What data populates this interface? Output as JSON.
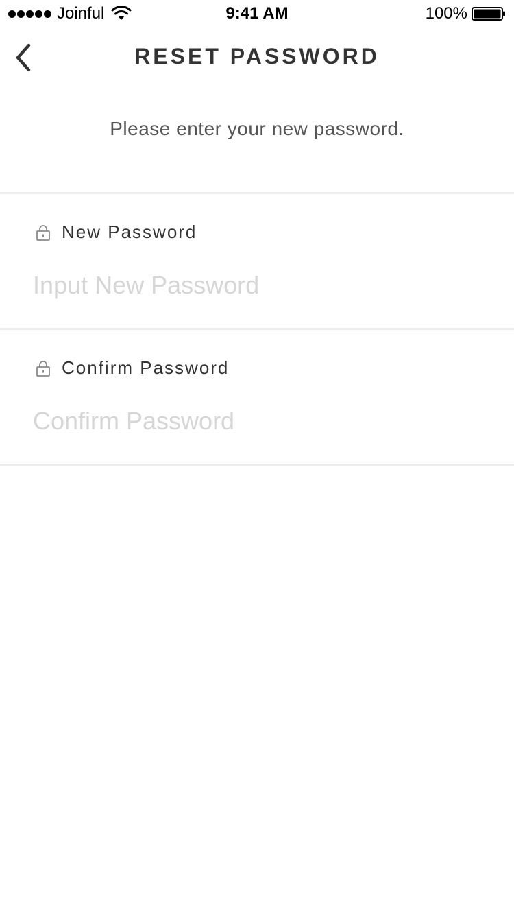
{
  "status_bar": {
    "carrier": "Joinful",
    "time": "9:41 AM",
    "battery_percent": "100%",
    "signal_icon": "signal-dots-icon",
    "wifi_icon": "wifi-icon",
    "battery_icon": "battery-full-icon"
  },
  "header": {
    "back_icon": "chevron-left-icon",
    "title": "RESET PASSWORD"
  },
  "instruction": "Please enter your new password.",
  "fields": [
    {
      "icon": "lock-icon",
      "label": "New Password",
      "placeholder": "Input New Password",
      "value": ""
    },
    {
      "icon": "lock-icon",
      "label": "Confirm Password",
      "placeholder": "Confirm Password",
      "value": ""
    }
  ],
  "colors": {
    "text_primary": "#333333",
    "text_secondary": "#555555",
    "placeholder": "#d6d6d6",
    "divider": "#ececec",
    "background": "#ffffff"
  }
}
